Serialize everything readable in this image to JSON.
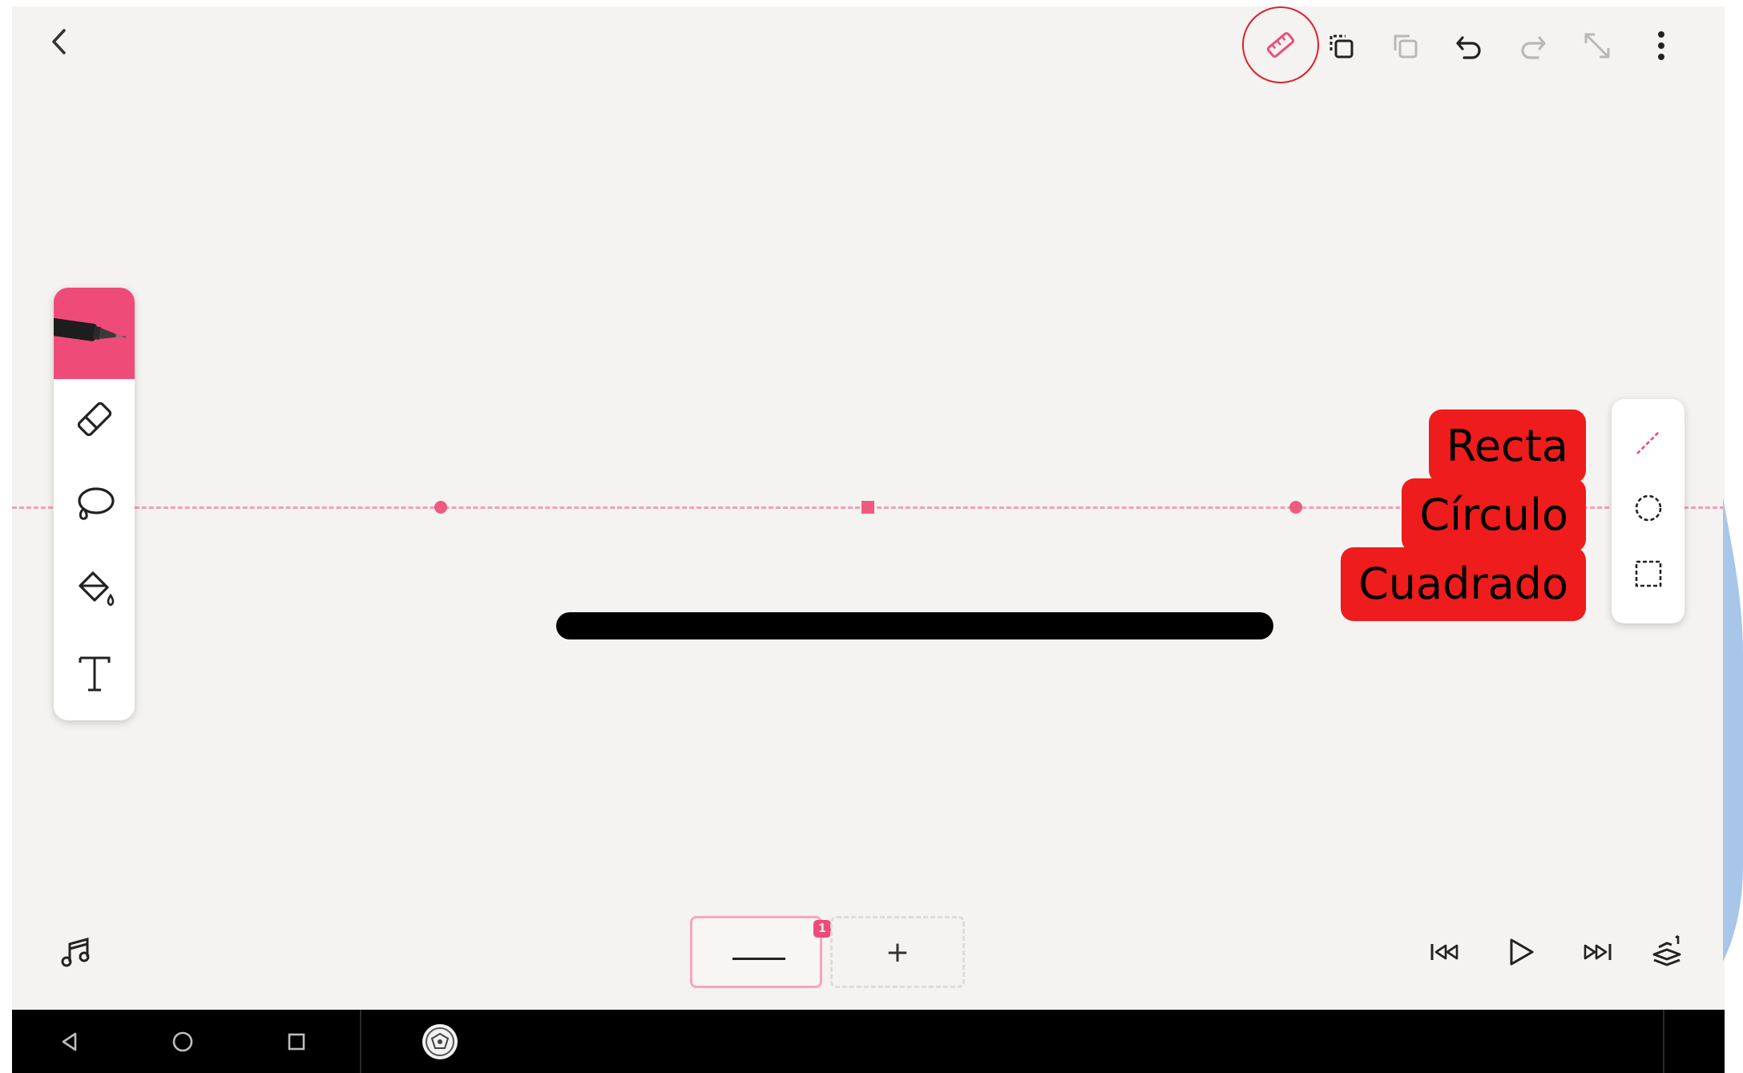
{
  "topbar": {
    "icons": [
      "back-icon",
      "ruler-icon",
      "duplicate-icon",
      "copy-icon",
      "undo-icon",
      "redo-icon",
      "expand-icon",
      "more-icon"
    ]
  },
  "tools": [
    "pen-icon",
    "eraser-icon",
    "lasso-icon",
    "fill-bucket-icon",
    "text-tool-icon"
  ],
  "shape_panel": {
    "options": [
      "line-shape-icon",
      "circle-shape-icon",
      "square-shape-icon"
    ]
  },
  "labels": {
    "line": "Recta",
    "circle": "Círculo",
    "square": "Cuadrado"
  },
  "timeline": {
    "frame_badge": "1",
    "add_frame": "+"
  },
  "colors": {
    "accent": "#ef4b79",
    "label_background": "#ee1c1c",
    "canvas": "#f4f3f1",
    "guide": "#f2a0b6"
  }
}
